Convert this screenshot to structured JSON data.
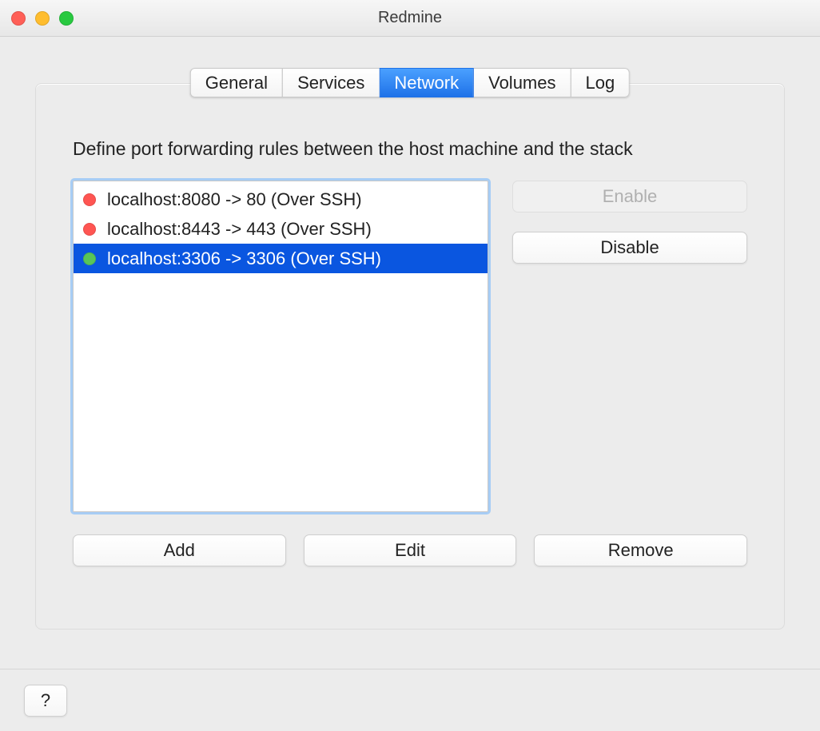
{
  "window": {
    "title": "Redmine"
  },
  "tabs": {
    "items": [
      {
        "label": "General"
      },
      {
        "label": "Services"
      },
      {
        "label": "Network"
      },
      {
        "label": "Volumes"
      },
      {
        "label": "Log"
      }
    ],
    "active_index": 2
  },
  "description": "Define port forwarding rules between the host machine and the stack",
  "rules": [
    {
      "status": "red",
      "text": "localhost:8080 -> 80 (Over SSH)",
      "selected": false
    },
    {
      "status": "red",
      "text": "localhost:8443 -> 443 (Over SSH)",
      "selected": false
    },
    {
      "status": "green",
      "text": "localhost:3306 -> 3306 (Over SSH)",
      "selected": true
    }
  ],
  "side_buttons": {
    "enable": {
      "label": "Enable",
      "disabled": true
    },
    "disable": {
      "label": "Disable",
      "disabled": false
    }
  },
  "bottom_buttons": {
    "add": "Add",
    "edit": "Edit",
    "remove": "Remove"
  },
  "help_button": "?"
}
